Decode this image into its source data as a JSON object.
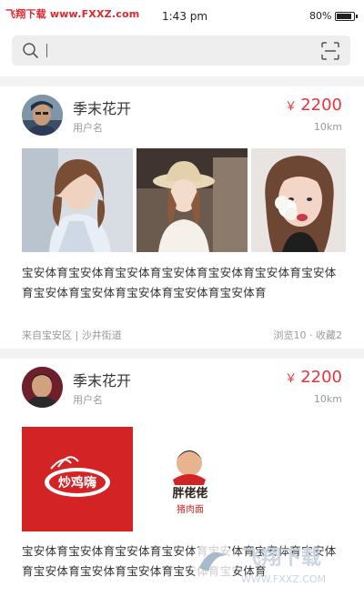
{
  "status_bar": {
    "watermark": "飞翔下载 www.FXXZ.com",
    "time": "1:43 pm",
    "battery": "80%"
  },
  "search": {
    "placeholder": "",
    "value": ""
  },
  "icons": {
    "search": "search-icon",
    "scan": "scan-icon",
    "battery": "battery-icon"
  },
  "colors": {
    "price": "#e8333b",
    "logo_background": "#d42325"
  },
  "listings": [
    {
      "name": "季末花开",
      "subtitle": "用户名",
      "price_symbol": "￥",
      "price": "2200",
      "distance": "10km",
      "description": "宝安体育宝安体育宝安体育宝安体育宝安体育宝安体育宝安体育宝安体育宝安体育宝安体育宝安体育宝安体育",
      "location": "来自宝安区 | 沙井街道",
      "stats": "浏览10 · 收藏2"
    },
    {
      "name": "季末花开",
      "subtitle": "用户名",
      "price_symbol": "￥",
      "price": "2200",
      "distance": "10km",
      "description": "宝安体育宝安体育宝安体育宝安体育宝安体育宝安体育宝安体育宝安体育宝安体育宝安体育宝安体育宝安体育",
      "logo_1_text": "炒鸡嗨",
      "logo_2_text": "胖佬佬",
      "logo_2_subtext": "猪肉面"
    }
  ],
  "watermark_bottom": {
    "title": "飞翔下载",
    "url": "WWW.FXXZ.COM"
  }
}
